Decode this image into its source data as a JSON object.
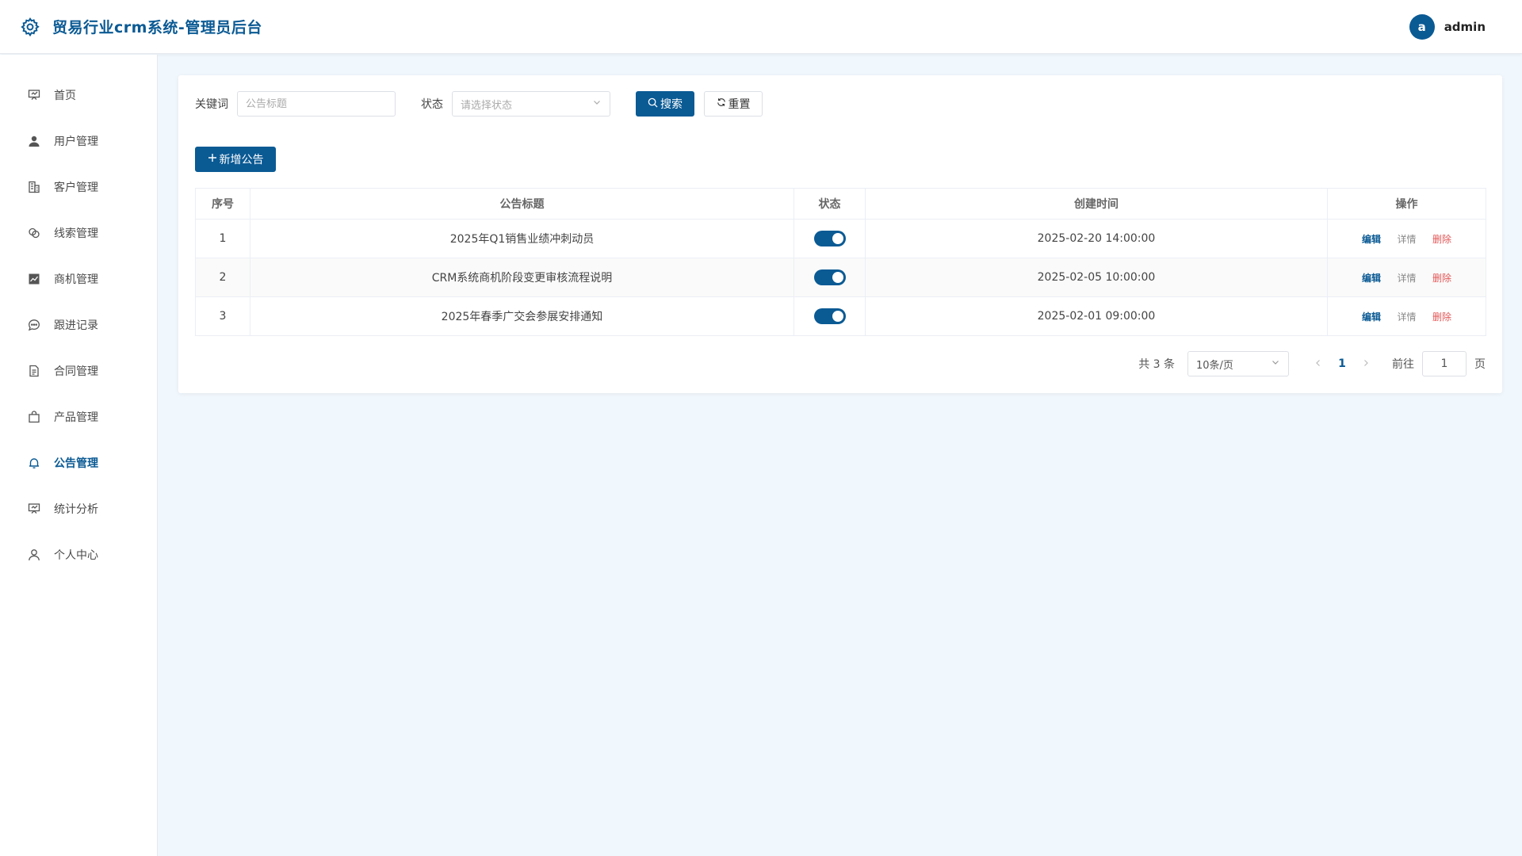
{
  "header": {
    "title": "贸易行业crm系统-管理员后台",
    "avatar_letter": "a",
    "username": "admin"
  },
  "sidebar": {
    "items": [
      {
        "label": "首页",
        "icon": "presentation-icon"
      },
      {
        "label": "用户管理",
        "icon": "user-icon"
      },
      {
        "label": "客户管理",
        "icon": "building-icon"
      },
      {
        "label": "线索管理",
        "icon": "link-icon"
      },
      {
        "label": "商机管理",
        "icon": "chart-icon"
      },
      {
        "label": "跟进记录",
        "icon": "chat-icon"
      },
      {
        "label": "合同管理",
        "icon": "document-icon"
      },
      {
        "label": "产品管理",
        "icon": "bag-icon"
      },
      {
        "label": "公告管理",
        "icon": "bell-icon"
      },
      {
        "label": "统计分析",
        "icon": "presentation-icon"
      },
      {
        "label": "个人中心",
        "icon": "person-icon"
      }
    ],
    "active_index": 8
  },
  "filters": {
    "keyword_label": "关键词",
    "keyword_placeholder": "公告标题",
    "status_label": "状态",
    "status_placeholder": "请选择状态",
    "search_label": "搜索",
    "reset_label": "重置"
  },
  "add_button_label": "新增公告",
  "table": {
    "headers": [
      "序号",
      "公告标题",
      "状态",
      "创建时间",
      "操作"
    ],
    "rows": [
      {
        "index": "1",
        "title": "2025年Q1销售业绩冲刺动员",
        "status_on": true,
        "created": "2025-02-20 14:00:00"
      },
      {
        "index": "2",
        "title": "CRM系统商机阶段变更审核流程说明",
        "status_on": true,
        "created": "2025-02-05 10:00:00"
      },
      {
        "index": "3",
        "title": "2025年春季广交会参展安排通知",
        "status_on": true,
        "created": "2025-02-01 09:00:00"
      }
    ],
    "actions": {
      "edit": "编辑",
      "detail": "详情",
      "delete": "删除"
    }
  },
  "pagination": {
    "total_text": "共 3 条",
    "page_size": "10条/页",
    "current_page": "1",
    "goto_label": "前往",
    "goto_value": "1",
    "page_suffix": "页"
  },
  "colors": {
    "primary": "#0a5a94",
    "danger": "#e45656",
    "background": "#f0f7fd"
  }
}
